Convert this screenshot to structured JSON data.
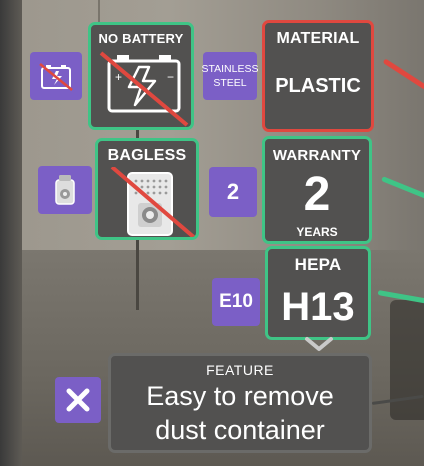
{
  "tiles": {
    "no_battery": {
      "label": "NO BATTERY",
      "icon": "crossed-battery-icon"
    },
    "material": {
      "label": "MATERIAL",
      "value": "PLASTIC"
    },
    "bagless": {
      "label": "BAGLESS",
      "icon": "crossed-dust-bag-icon"
    },
    "warranty": {
      "label": "WARRANTY",
      "value": "2",
      "unit": "YEARS"
    },
    "hepa": {
      "label": "HEPA",
      "value": "H13"
    },
    "feature": {
      "label": "FEATURE",
      "line1": "Easy to remove",
      "line2": "dust container"
    }
  },
  "badges": {
    "battery": {
      "icon": "crossed-battery-icon"
    },
    "material_alt": {
      "line1": "STAINLESS",
      "line2": "STEEL"
    },
    "bag": {
      "icon": "dust-bag-icon"
    },
    "warranty_alt": {
      "value": "2"
    },
    "hepa_alt": {
      "value": "E10"
    },
    "feature_alt": {
      "icon": "close-x-icon"
    }
  },
  "colors": {
    "match": "#3fc486",
    "mismatch": "#e0483f",
    "alternative": "#7b5fc6",
    "tile_bg": "#525150"
  }
}
